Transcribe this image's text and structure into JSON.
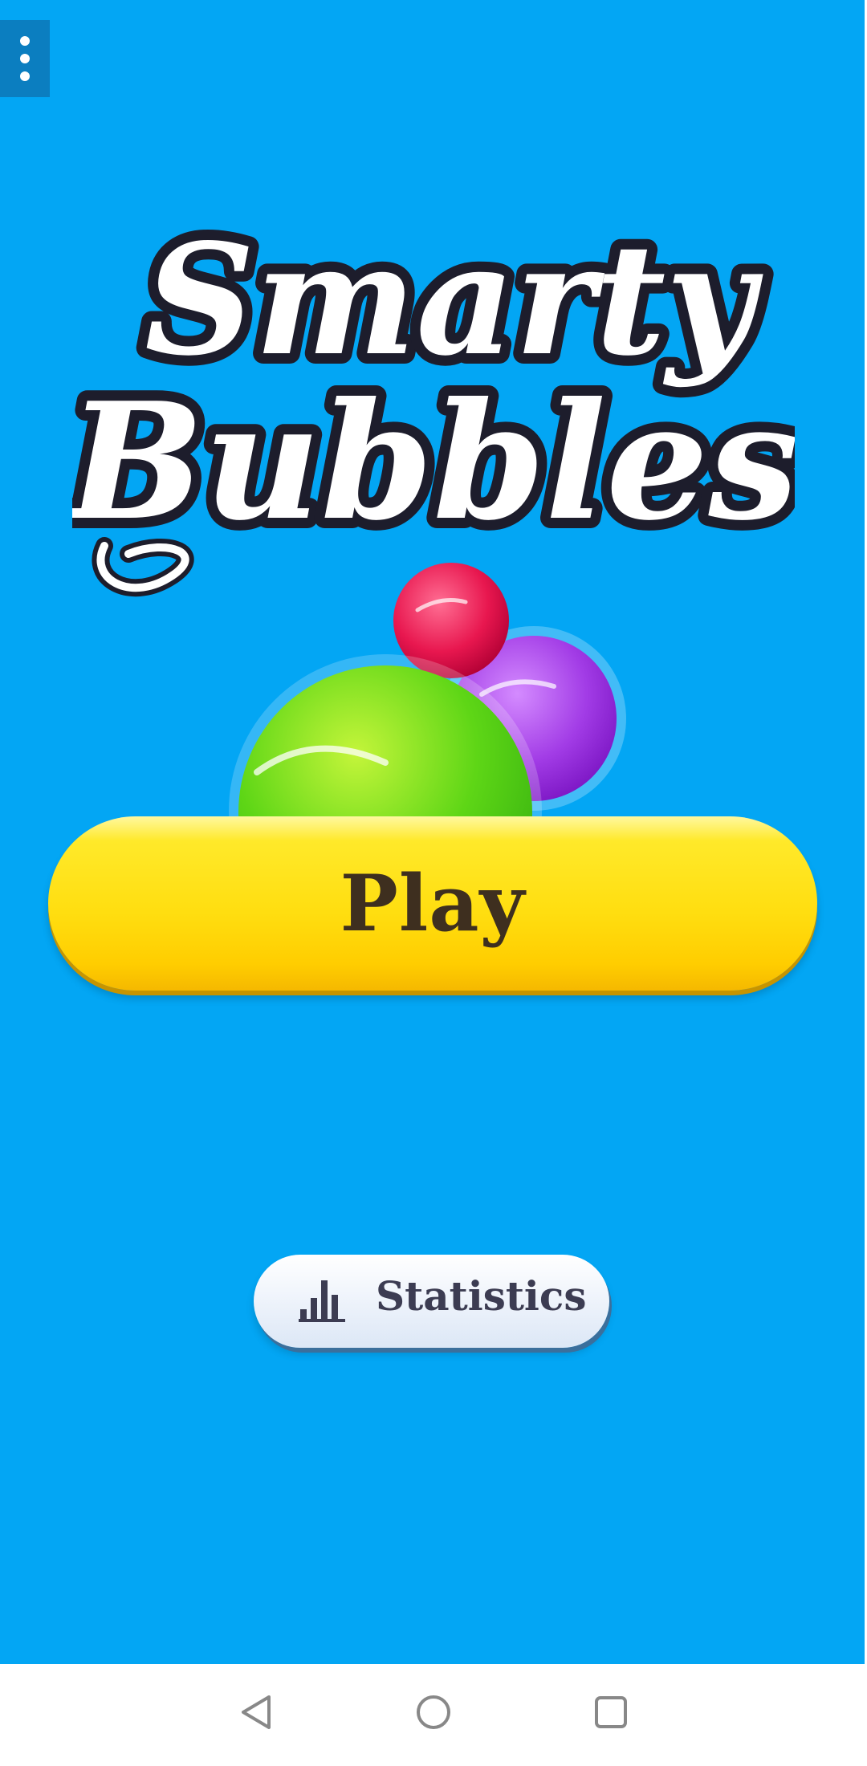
{
  "title": {
    "line1": "Smarty",
    "line2": "Bubbles"
  },
  "buttons": {
    "play_label": "Play",
    "statistics_label": "Statistics"
  },
  "icons": {
    "menu": "more-vert-icon",
    "statistics": "bar-chart-icon",
    "nav_back": "back-triangle-icon",
    "nav_home": "home-circle-icon",
    "nav_recents": "recents-square-icon"
  },
  "colors": {
    "background": "#03a6f4",
    "play_button": "#ffde10",
    "play_text": "#3e2f1f",
    "stats_text": "#3c3c52",
    "bubble_red": "#e8174f",
    "bubble_purple": "#a23ce6",
    "bubble_green": "#5ed616"
  }
}
